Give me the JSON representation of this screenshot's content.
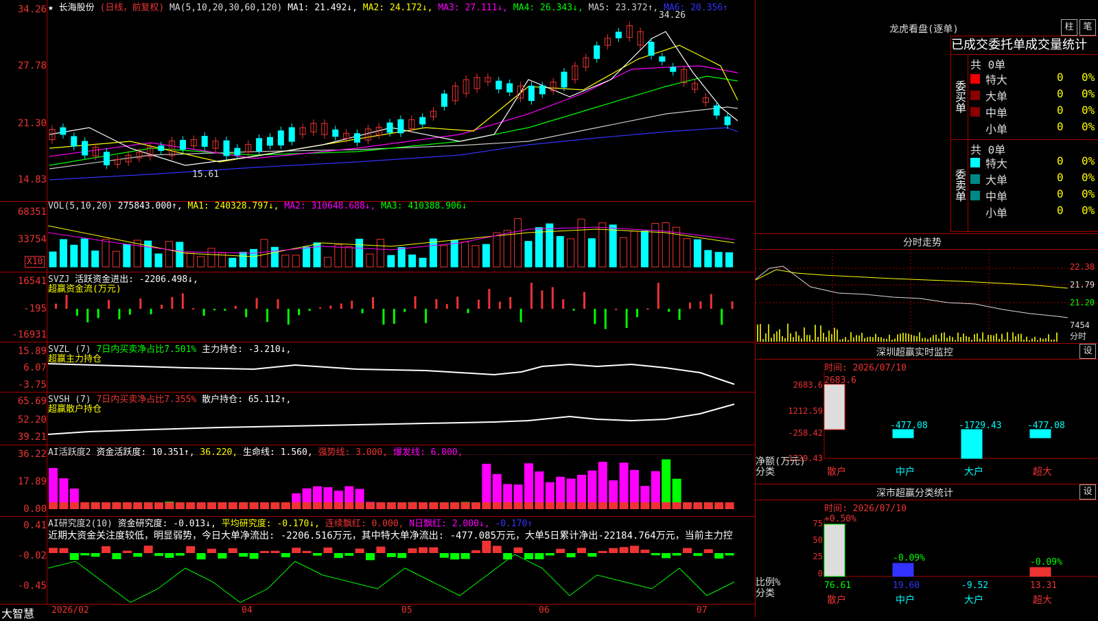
{
  "app": {
    "brand": "大智慧"
  },
  "main_chart": {
    "star": "★",
    "stock": "长海股份",
    "mode": "(日线，前复权)",
    "ma_label": "MA(5,10,20,30,60,120)",
    "ma1": "MA1: 21.492↓,",
    "ma2": "MA2: 24.172↓,",
    "ma3": "MA3: 27.111↓,",
    "ma4": "MA4: 26.343↓,",
    "ma5": "MA5: 23.372↑,",
    "ma6": "MA6: 20.356↑",
    "high_mark": "34.26",
    "low_mark": "15.61",
    "y_ticks": [
      "34.26",
      "27.78",
      "21.30",
      "14.83"
    ]
  },
  "vol_panel": {
    "label": "VOL(5,10,20)",
    "val": "275843.000↑,",
    "ma1": "MA1: 240328.797↓,",
    "ma2": "MA2: 310648.688↓,",
    "ma3": "MA3: 410388.906↓",
    "y_ticks": [
      "68351",
      "33754"
    ],
    "unit": "X10"
  },
  "svzj_panel": {
    "label": "SVZJ",
    "text": "活跃资金进出: -2206.498↓,",
    "sub": "超赢资金流(万元)",
    "y_ticks": [
      "16541",
      "-195",
      "-16931"
    ]
  },
  "svzl_panel": {
    "label": "SVZL (7)",
    "text1": "7日内买卖净占比7.501%",
    "text2": "主力持仓: -3.210↓,",
    "sub": "超赢主力持仓",
    "y_ticks": [
      "15.89",
      "6.07",
      "-3.75"
    ]
  },
  "svsh_panel": {
    "label": "SVSH (7)",
    "text1": "7日内买卖净占比7.355%",
    "text2": "散户持仓: 65.112↑,",
    "sub": "超赢散户持仓",
    "y_ticks": [
      "65.69",
      "52.20",
      "39.21"
    ]
  },
  "ai_active": {
    "label": "AI活跃度2",
    "t1": "资金活跃度: 10.351↑,",
    "t2": "36.220,",
    "t3": "生命线: 1.560,",
    "t4": "强势线: 3.000,",
    "t5": "爆发线: 6.000,",
    "y_ticks": [
      "36.22",
      "17.89",
      "0.00"
    ]
  },
  "ai_research": {
    "label": "AI研究度2(10)",
    "t1": "资金研究度: -0.013↓,",
    "t2": "平均研究度: -0.170↓,",
    "t3": "连续飘红: 0.000,",
    "t4": "N日飘红: 2.000↓,",
    "t5": "-0.170↑",
    "note": "近期大资金关注度较低，明显弱势，今日大单净流出: -2206.516万元，其中特大单净流出: -477.085万元，大单5日累计净出-22184.764万元，当前主力控",
    "y_ticks": [
      "0.41",
      "-0.02",
      "-0.45"
    ]
  },
  "x_axis": [
    "2026/02",
    "04",
    "05",
    "06",
    "07"
  ],
  "right": {
    "lhb": {
      "title": "龙虎看盘(逐单)",
      "btn_bar": "柱",
      "btn_pen": "笔",
      "header": "已成交委托单成交量统计",
      "buy": {
        "side": "委买单",
        "total": "共 0单",
        "rows": [
          {
            "label": "特大",
            "count": "0",
            "pct": "0%"
          },
          {
            "label": "大单",
            "count": "0",
            "pct": "0%"
          },
          {
            "label": "中单",
            "count": "0",
            "pct": "0%"
          },
          {
            "label": "小单",
            "count": "0",
            "pct": "0%"
          }
        ]
      },
      "sell": {
        "side": "委卖单",
        "total": "共 0单",
        "rows": [
          {
            "label": "特大",
            "count": "0",
            "pct": "0%"
          },
          {
            "label": "大单",
            "count": "0",
            "pct": "0%"
          },
          {
            "label": "中单",
            "count": "0",
            "pct": "0%"
          },
          {
            "label": "小单",
            "count": "0",
            "pct": "0%"
          }
        ]
      }
    },
    "intraday": {
      "title": "分时走势",
      "p1": "22.38",
      "p2": "21.79",
      "p3": "21.20",
      "vol": "7454",
      "unit": "分时"
    },
    "monitor": {
      "title": "深圳超赢实时监控",
      "btn": "设",
      "time": "时间: 2026/07/10",
      "y_ticks": [
        "2683.6",
        "1212.59",
        "-258.42",
        "-1729.43"
      ],
      "ylabel": "净额(万元)",
      "xlabel": "分类",
      "categories": [
        "散户",
        "中户",
        "大户",
        "超大"
      ],
      "values": [
        "2683.6",
        "-477.08",
        "-1729.43",
        "-477.08"
      ]
    },
    "classify": {
      "title": "深市超赢分类统计",
      "btn": "设",
      "time": "时间: 2026/07/10",
      "y_ticks": [
        "75",
        "50",
        "25",
        "0"
      ],
      "ylabel": "比例%",
      "xlabel": "分类",
      "categories": [
        "散户",
        "中户",
        "大户",
        "超大"
      ],
      "top": [
        "+0.50%",
        "-0.09%",
        "",
        "-0.09%"
      ],
      "bottom": [
        "76.61",
        "19.60",
        "-9.52",
        "13.31"
      ]
    }
  }
}
